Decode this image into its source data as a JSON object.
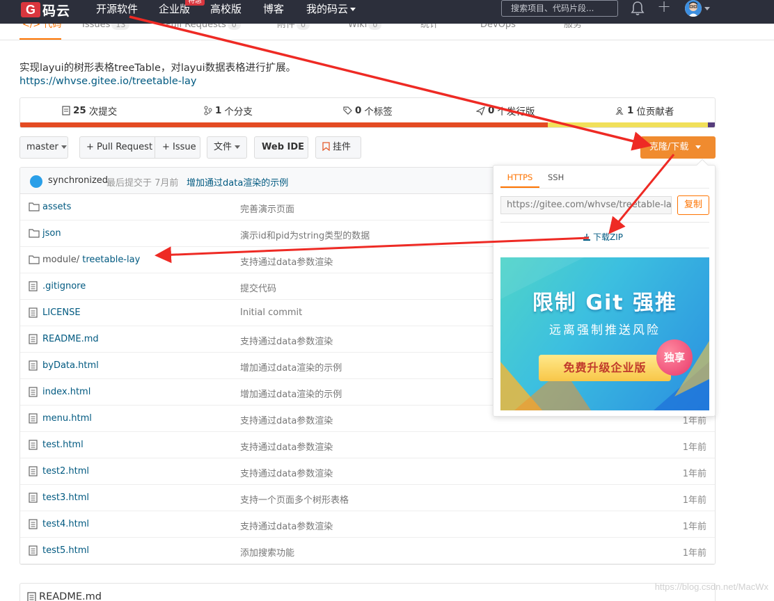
{
  "topnav": {
    "logo_letter": "G",
    "logo_text": "码云",
    "items": [
      "开源软件",
      "企业版",
      "高校版",
      "博客",
      "我的码云"
    ],
    "hot_badge": "特惠",
    "search_placeholder": "搜索项目、代码片段..."
  },
  "tabs": [
    {
      "label": "代码",
      "count": ""
    },
    {
      "label": "Issues",
      "count": "13"
    },
    {
      "label": "Pull Requests",
      "count": "0"
    },
    {
      "label": "附件",
      "count": "0"
    },
    {
      "label": "Wiki",
      "count": "0"
    },
    {
      "label": "统计",
      "count": ""
    },
    {
      "label": "DevOps",
      "count": ""
    },
    {
      "label": "服务",
      "count": ""
    }
  ],
  "description": "实现layui的树形表格treeTable，对layui数据表格进行扩展。",
  "homepage": "https://whvse.gitee.io/treetable-lay",
  "stats": [
    {
      "num": "25",
      "label": "次提交"
    },
    {
      "num": "1",
      "label": "个分支"
    },
    {
      "num": "0",
      "label": "个标签"
    },
    {
      "num": "0",
      "label": "个发行版"
    },
    {
      "num": "1",
      "label": "位贡献者"
    }
  ],
  "language_bar": [
    {
      "color": "#e44b23",
      "share": 0.76
    },
    {
      "color": "#f1e05a",
      "share": 0.23
    },
    {
      "color": "#563d7c",
      "share": 0.01
    }
  ],
  "toolbar": {
    "branch": "master",
    "pull_request": "+ Pull Request",
    "issue": "+ Issue",
    "files": "文件",
    "web_ide": "Web IDE",
    "widget": "挂件",
    "clone": "克隆/下载"
  },
  "last_commit": {
    "user": "synchronized",
    "meta": "最后提交于 7月前",
    "message": "增加通过data渲染的示例"
  },
  "files": [
    {
      "type": "folder",
      "prefix": "",
      "name": "assets",
      "message": "完善演示页面",
      "time": ""
    },
    {
      "type": "folder",
      "prefix": "",
      "name": "json",
      "message": "演示id和pid为string类型的数据",
      "time": ""
    },
    {
      "type": "folder",
      "prefix": "module/ ",
      "name": "treetable-lay",
      "message": "支持通过data参数渲染",
      "time": ""
    },
    {
      "type": "file",
      "prefix": "",
      "name": ".gitignore",
      "message": "提交代码",
      "time": ""
    },
    {
      "type": "file",
      "prefix": "",
      "name": "LICENSE",
      "message": "Initial commit",
      "time": ""
    },
    {
      "type": "file",
      "prefix": "",
      "name": "README.md",
      "message": "支持通过data参数渲染",
      "time": ""
    },
    {
      "type": "file",
      "prefix": "",
      "name": "byData.html",
      "message": "增加通过data渲染的示例",
      "time": ""
    },
    {
      "type": "file",
      "prefix": "",
      "name": "index.html",
      "message": "增加通过data渲染的示例",
      "time": ""
    },
    {
      "type": "file",
      "prefix": "",
      "name": "menu.html",
      "message": "支持通过data参数渲染",
      "time": "1年前"
    },
    {
      "type": "file",
      "prefix": "",
      "name": "test.html",
      "message": "支持通过data参数渲染",
      "time": "1年前"
    },
    {
      "type": "file",
      "prefix": "",
      "name": "test2.html",
      "message": "支持通过data参数渲染",
      "time": "1年前"
    },
    {
      "type": "file",
      "prefix": "",
      "name": "test3.html",
      "message": "支持一个页面多个树形表格",
      "time": "1年前"
    },
    {
      "type": "file",
      "prefix": "",
      "name": "test4.html",
      "message": "支持通过data参数渲染",
      "time": "1年前"
    },
    {
      "type": "file",
      "prefix": "",
      "name": "test5.html",
      "message": "添加搜索功能",
      "time": "1年前"
    }
  ],
  "clone_popover": {
    "tab_https": "HTTPS",
    "tab_ssh": "SSH",
    "url": "https://gitee.com/whvse/treetable-lay.git",
    "copy": "复制",
    "download_zip": "下载ZIP",
    "ad": {
      "title": "限制 Git 强推",
      "subtitle": "远离强制推送风险",
      "button": "免费升级企业版",
      "badge": "独享"
    }
  },
  "readme_title": "README.md",
  "watermark": "https://blog.csdn.net/MacWx",
  "colors": {
    "accent": "#fe7300",
    "clone_button": "#f08b2f",
    "link": "#005980",
    "nav_bg": "#2c2f3b",
    "annotation_arrow": "#ee2a24"
  }
}
